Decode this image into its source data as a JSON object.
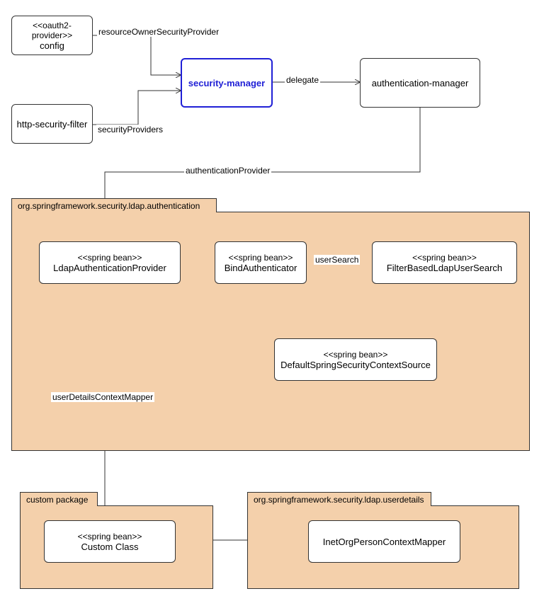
{
  "nodes": {
    "config": {
      "stereotype": "<<oauth2-provider>>",
      "name": "config"
    },
    "httpFilter": {
      "stereotype": "",
      "name": "http-security-filter"
    },
    "securityManager": {
      "stereotype": "",
      "name": "security-manager"
    },
    "authManager": {
      "stereotype": "",
      "name": "authentication-manager"
    },
    "ldapAuthProvider": {
      "stereotype": "<<spring bean>>",
      "name": "LdapAuthenticationProvider"
    },
    "bindAuth": {
      "stereotype": "<<spring bean>>",
      "name": "BindAuthenticator"
    },
    "filterSearch": {
      "stereotype": "<<spring bean>>",
      "name": "FilterBasedLdapUserSearch"
    },
    "defaultCtx": {
      "stereotype": "<<spring bean>>",
      "name": "DefaultSpringSecurityContextSource"
    },
    "customClass": {
      "stereotype": "<<spring bean>>",
      "name": "Custom Class"
    },
    "inetOrg": {
      "stereotype": "",
      "name": "InetOrgPersonContextMapper"
    }
  },
  "packages": {
    "ldapAuth": {
      "label": "org.springframework.security.ldap.authentication",
      "color": "#f4d0ab"
    },
    "custom": {
      "label": "custom package",
      "color": "#f4d0ab"
    },
    "userdetails": {
      "label": "org.springframework.security.ldap.userdetails",
      "color": "#f4d0ab"
    }
  },
  "edges": {
    "resourceOwner": "resourceOwnerSecurityProvider",
    "securityProviders": "securityProviders",
    "delegate": "delegate",
    "authProvider": "authenticationProvider",
    "userSearch": "userSearch",
    "userDetailsMapper": "userDetailsContextMapper"
  }
}
